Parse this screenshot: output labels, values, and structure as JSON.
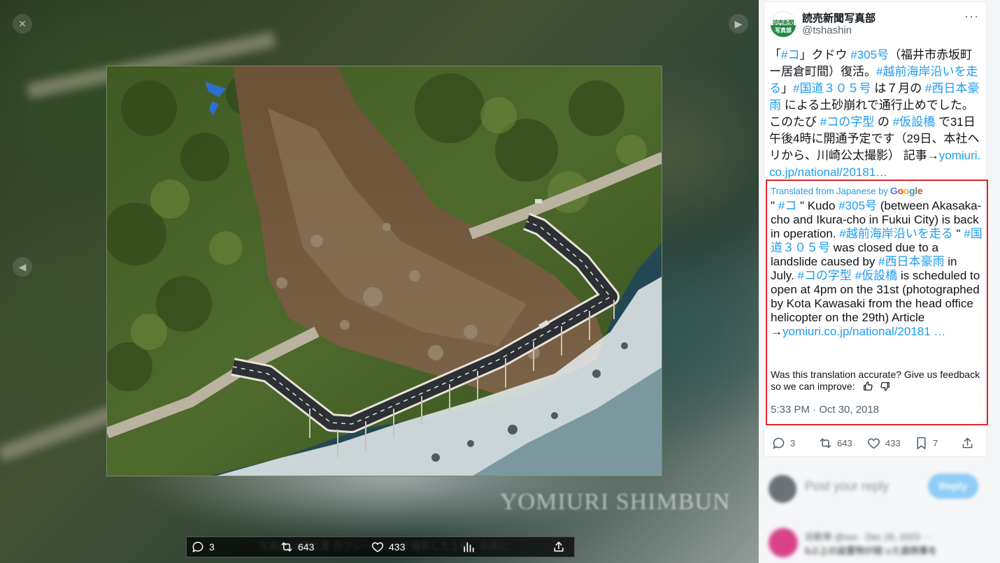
{
  "media": {
    "watermark": "YOMIURI SHIMBUN",
    "actions": {
      "reply_count": "3",
      "retweet_count": "643",
      "like_count": "433"
    },
    "blurred_caption": "写真部 は撮位置 のフレーミングで撮影した１枚。中央に"
  },
  "tweet": {
    "avatar_text_top": "読売新聞",
    "avatar_text_bottom": "写真部",
    "author_name": "読売新聞写真部",
    "author_handle": "@tshashin",
    "more_label": "···",
    "text": {
      "p1": "「",
      "t1": "#コ",
      "p2": "」クドウ ",
      "t2": "#305号",
      "p3": "（福井市赤坂町ー居倉町間）復活。",
      "t3": "#越前海岸沿いを走る",
      "p4": "」",
      "t4": "#国道３０５号",
      "p5": " は７月の ",
      "t5": "#西日本豪雨",
      "p6": " による土砂崩れで通行止めでした。このたび ",
      "t6": "#コの字型",
      "p7": " の ",
      "t7": "#仮設橋",
      "p8": " で31日午後4時に開通予定です（29日、本社ヘリから、川崎公太撮影） 記事→",
      "link": "yomiuri.co.jp/national/20181…"
    },
    "translation": {
      "label": "Translated from Japanese by",
      "google": [
        "G",
        "o",
        "o",
        "g",
        "l",
        "e"
      ],
      "q1": "\" ",
      "t1": "#コ",
      "q2": " \" Kudo ",
      "t2": "#305号",
      "s1": " (between Akasaka-cho and Ikura-cho in Fukui City) is back in operation. ",
      "t3": "#越前海岸沿いを走る",
      "q3": " \" ",
      "t4": "#国道３０５号",
      "s2": " was closed due to a landslide caused by ",
      "t5": "#西日本豪雨",
      "s3": " in July. ",
      "t6": "#コの字型",
      "t7": "#仮設橋",
      "s4": " is scheduled to open at 4pm on the 31st (photographed by Kota Kawasaki from the head office helicopter on the 29th) Article →",
      "link": "yomiuri.co.jp/national/20181 …"
    },
    "feedback_text": "Was this translation accurate? Give us feedback so we can improve:",
    "timestamp": "5:33 PM · Oct 30, 2018",
    "actions": {
      "reply_count": "3",
      "retweet_count": "643",
      "like_count": "433",
      "bookmark_count": "7"
    }
  },
  "reply": {
    "placeholder": "Post your reply",
    "button_label": "Reply",
    "item_meta": "自動車 @xxx · Dec 26, 2023 ···",
    "item_text": "6ぶ上の設置物が経った面倒事を"
  },
  "colors": {
    "accent": "#1d9bf0",
    "highlight_border": "#e0262b",
    "brand_green": "#1f8a45"
  }
}
